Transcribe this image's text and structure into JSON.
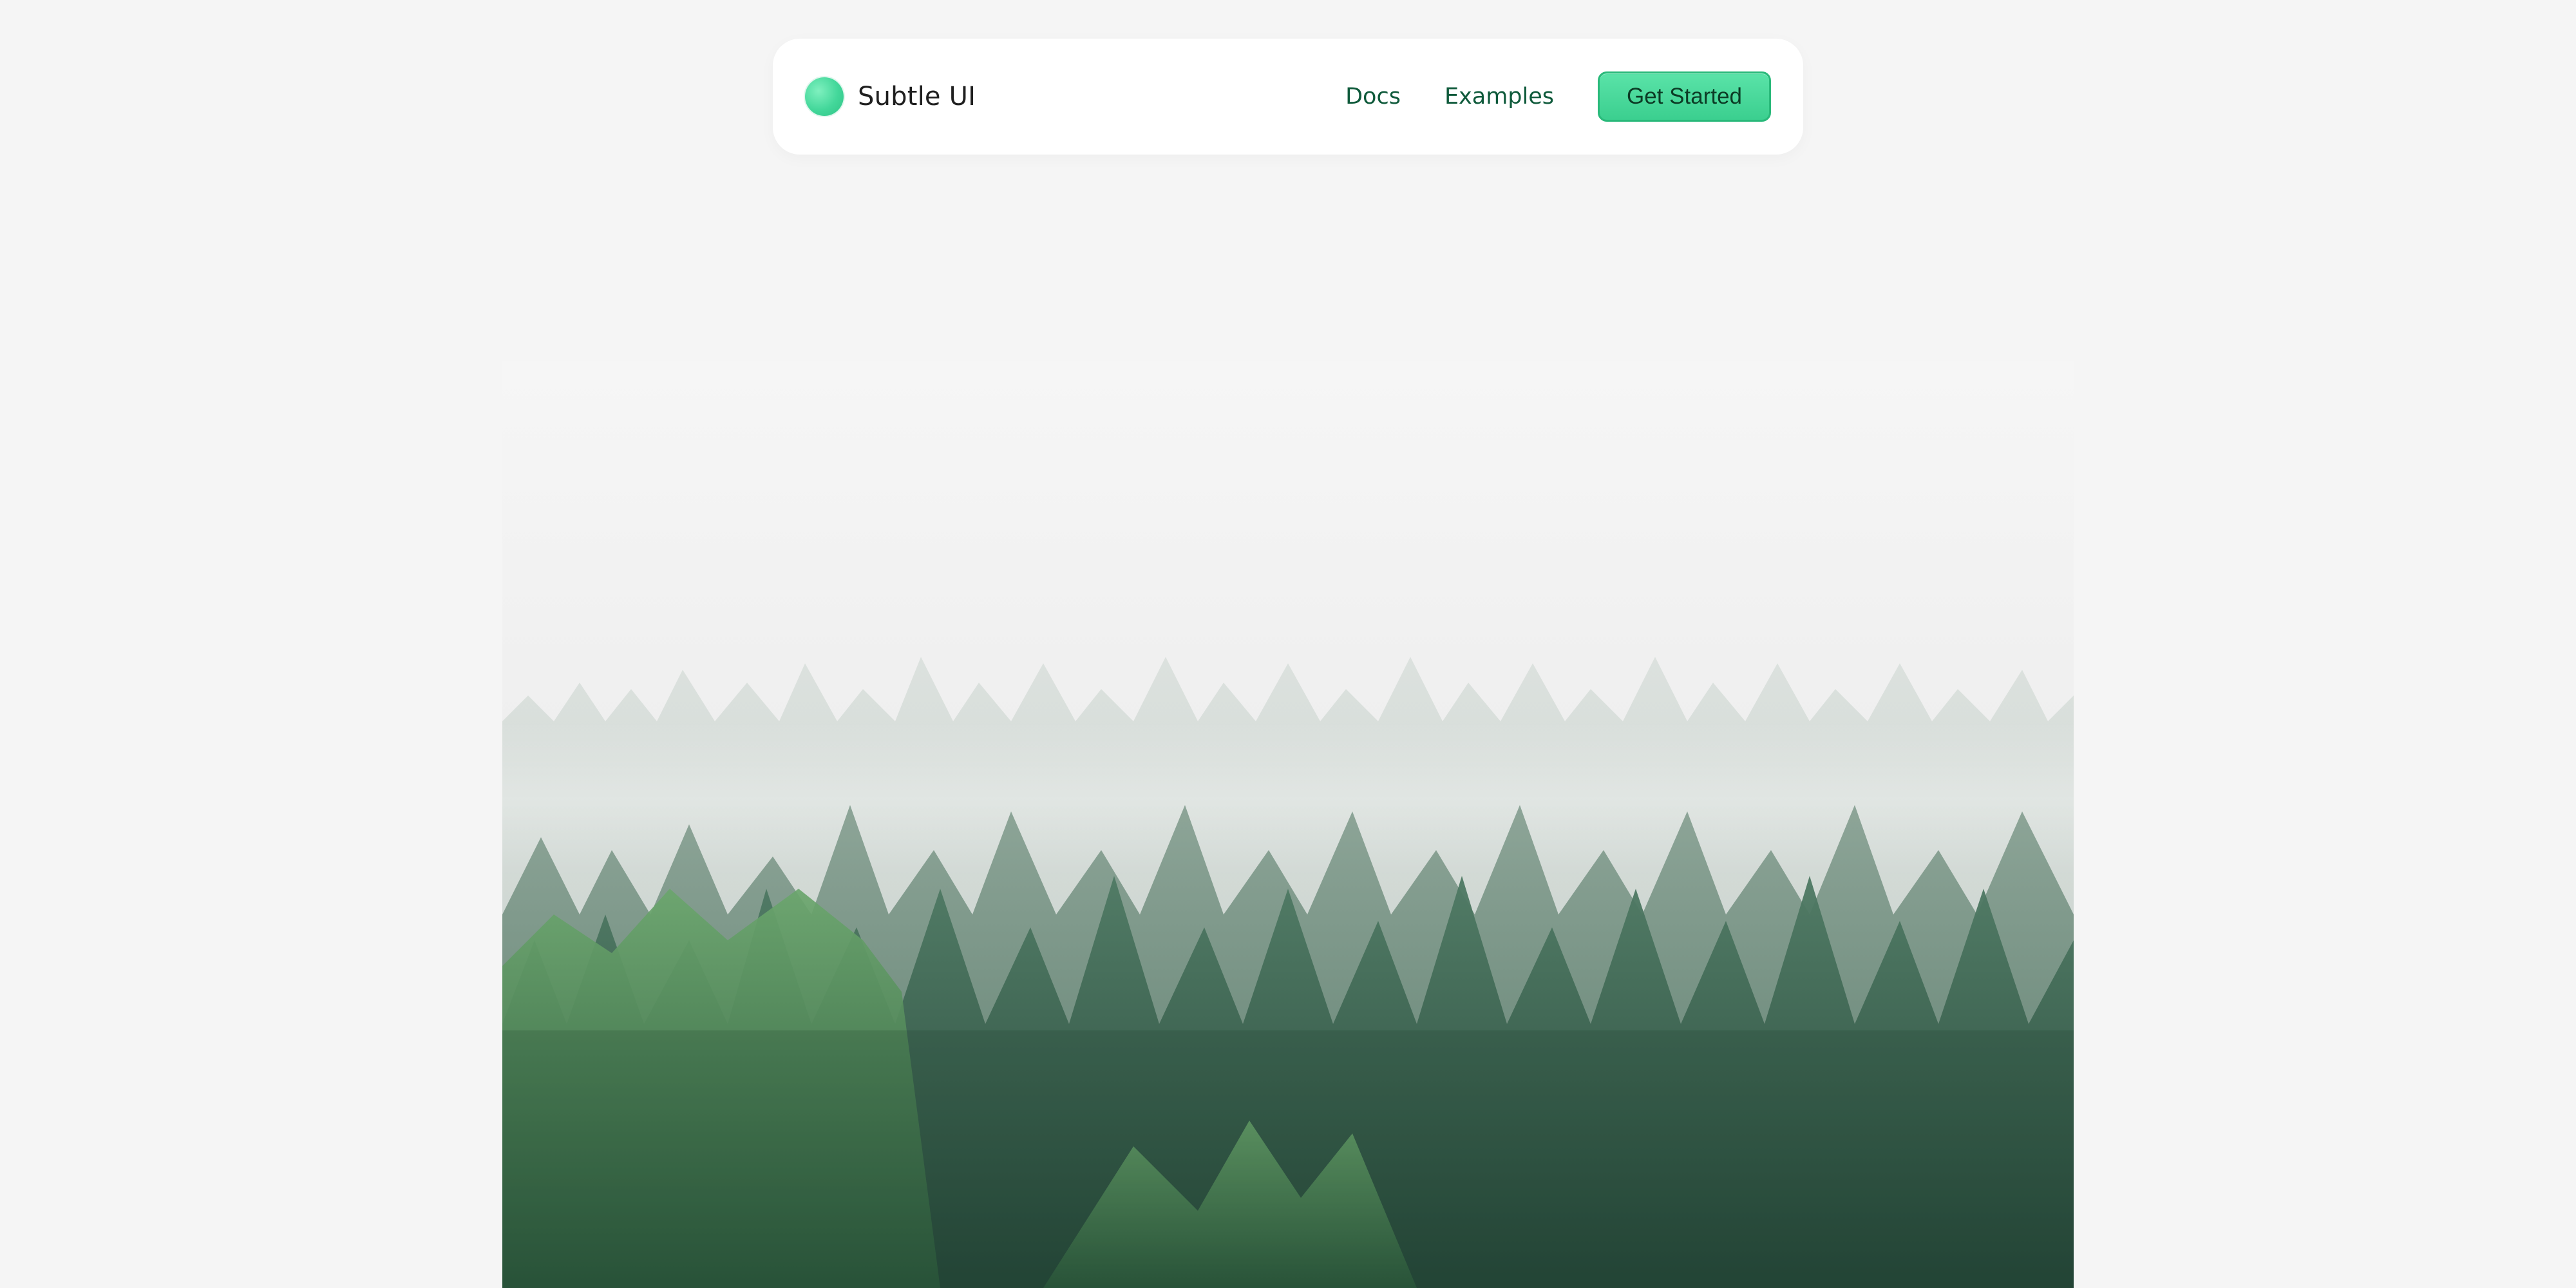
{
  "app": {
    "brand_name": "Subtle UI"
  },
  "nav": {
    "links": [
      {
        "label": "Docs"
      },
      {
        "label": "Examples"
      }
    ],
    "cta_label": "Get Started"
  },
  "colors": {
    "background": "#f5f5f5",
    "navbar": "#ffffff",
    "accent": "#43d79a",
    "link_text": "#0f5a3b",
    "cta_border": "#29b97a"
  },
  "hero": {
    "image_subject": "misty-pine-forest"
  }
}
